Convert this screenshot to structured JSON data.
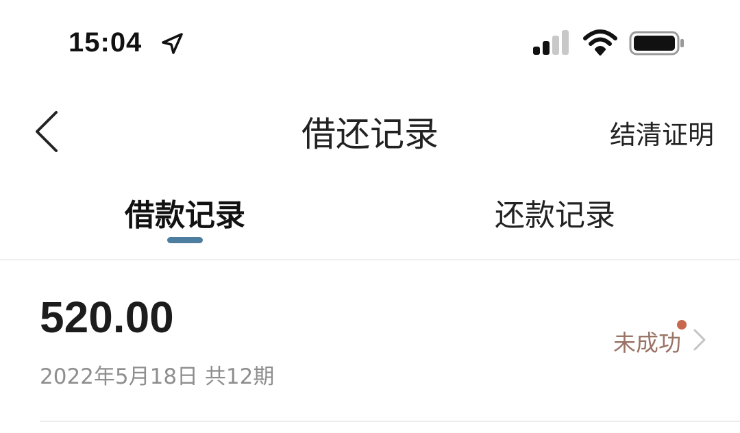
{
  "status_bar": {
    "time": "15:04",
    "icons": [
      "location-arrow-icon",
      "signal-icon",
      "wifi-icon",
      "battery-icon"
    ]
  },
  "header": {
    "title": "借还记录",
    "right_action": "结清证明",
    "back_icon": "chevron-left-icon"
  },
  "tabs": [
    {
      "label": "借款记录",
      "active": true
    },
    {
      "label": "还款记录",
      "active": false
    }
  ],
  "records": [
    {
      "amount": "520.00",
      "meta": "2022年5月18日 共12期",
      "status": "未成功"
    }
  ],
  "colors": {
    "tab_indicator": "#4d7ea0",
    "status_text": "#9a7466",
    "status_dot": "#c9674e",
    "secondary_text": "#8e8e8e"
  }
}
